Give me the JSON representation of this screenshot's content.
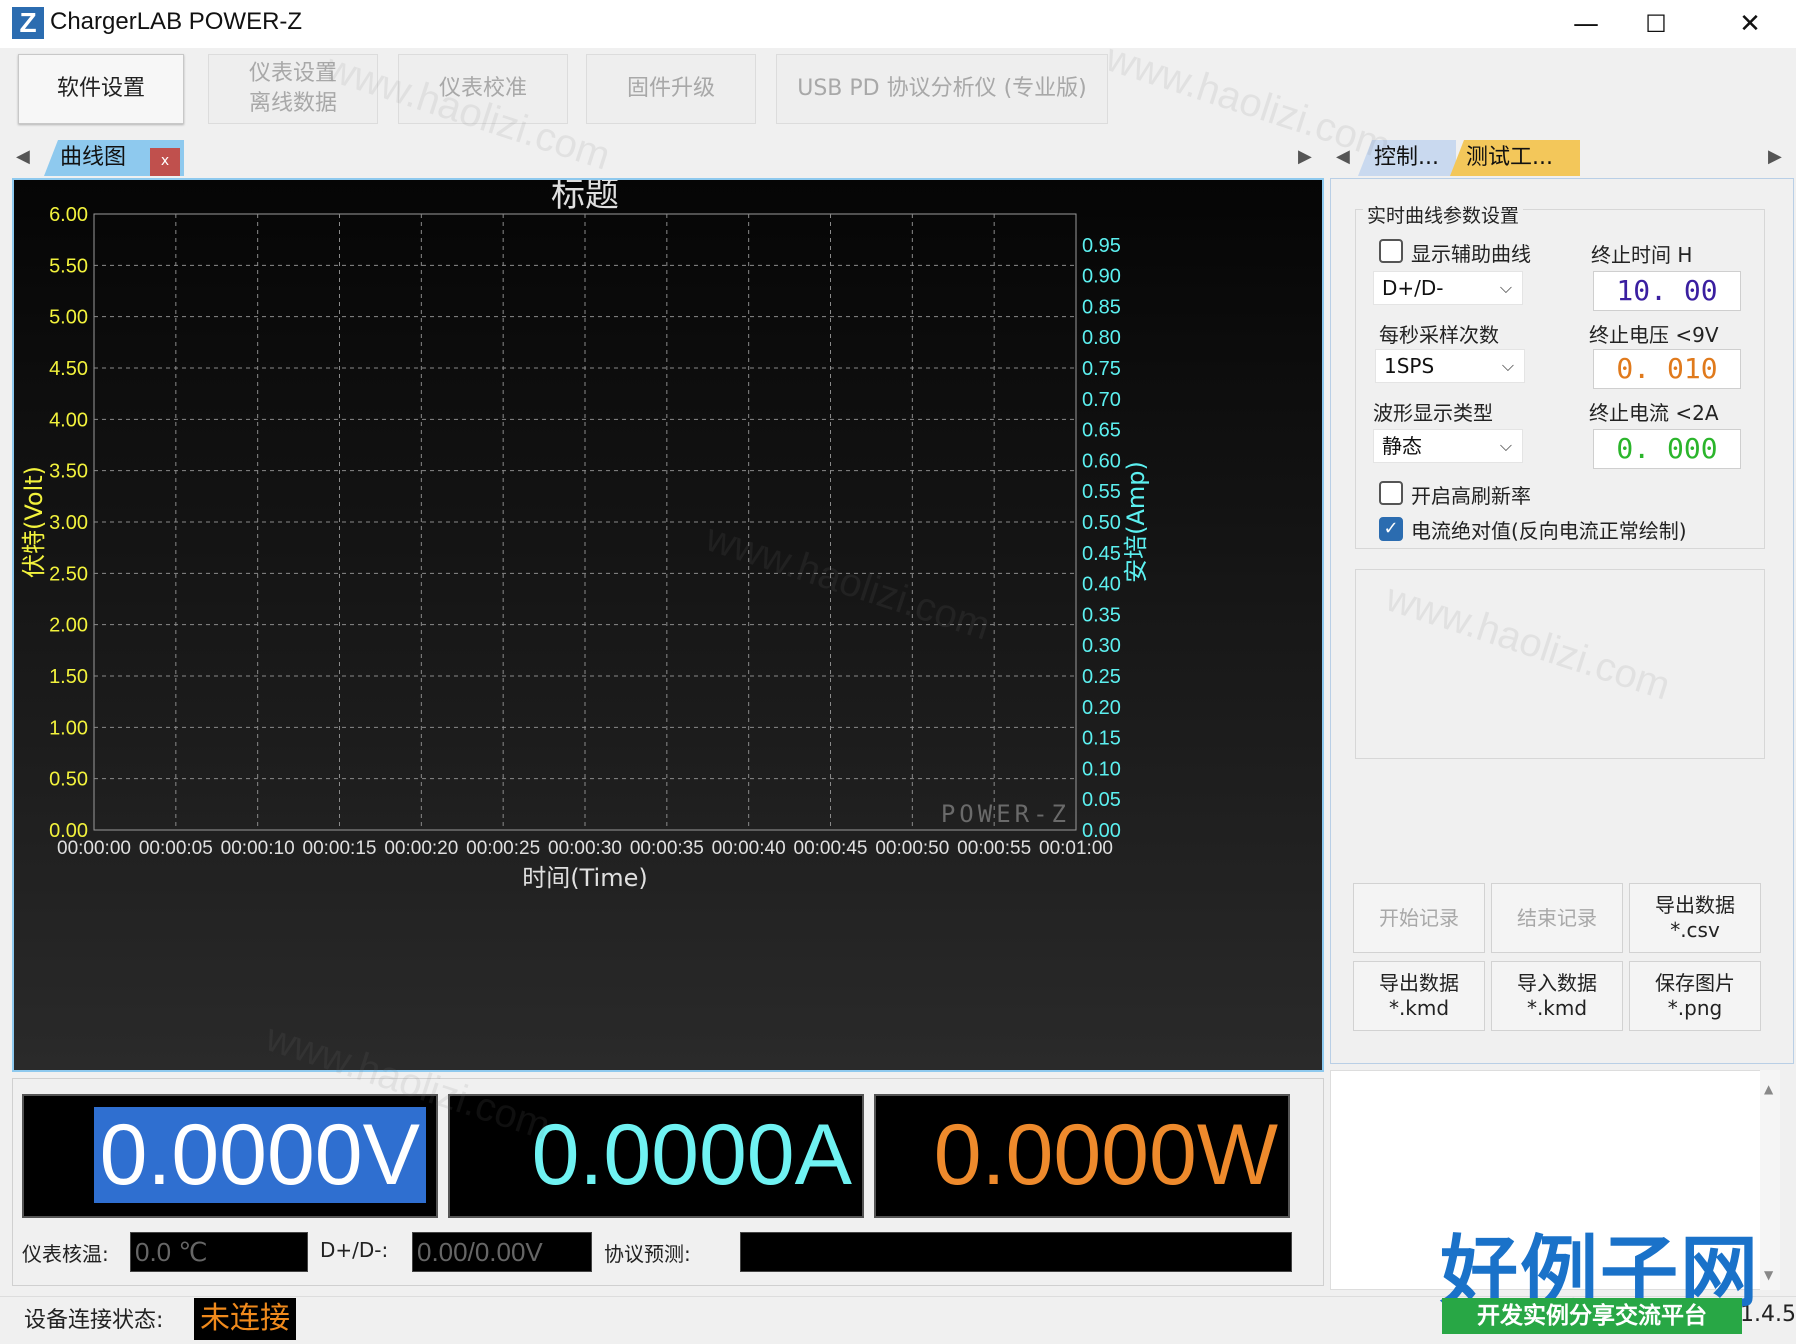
{
  "window": {
    "title": "ChargerLAB POWER-Z",
    "logo_glyph": "Z",
    "minimize": "—",
    "maximize": "☐",
    "close": "✕"
  },
  "toolbar": {
    "buttons": [
      {
        "label": "软件设置",
        "state": "active"
      },
      {
        "label": "仪表设置\n离线数据",
        "state": "disabled"
      },
      {
        "label": "仪表校准",
        "state": "disabled"
      },
      {
        "label": "固件升级",
        "state": "disabled"
      },
      {
        "label": "USB PD 协议分析仪 (专业版)",
        "state": "disabled"
      }
    ]
  },
  "left_tabs": {
    "active": "曲线图",
    "close": "x"
  },
  "right_tabs": {
    "tabs": [
      "控制...",
      "测试工..."
    ]
  },
  "chart_data": {
    "type": "line",
    "title": "标题",
    "xlabel": "时间(Time)",
    "ylabel_left": "伏特(Volt)",
    "ylabel_right": "安培(Amp)",
    "x_ticks": [
      "00:00:00",
      "00:00:05",
      "00:00:10",
      "00:00:15",
      "00:00:20",
      "00:00:25",
      "00:00:30",
      "00:00:35",
      "00:00:40",
      "00:00:45",
      "00:00:50",
      "00:00:55",
      "00:01:00"
    ],
    "y_left_ticks": [
      "0.00",
      "0.50",
      "1.00",
      "1.50",
      "2.00",
      "2.50",
      "3.00",
      "3.50",
      "4.00",
      "4.50",
      "5.00",
      "5.50",
      "6.00"
    ],
    "y_right_ticks": [
      "0.00",
      "0.05",
      "0.10",
      "0.15",
      "0.20",
      "0.25",
      "0.30",
      "0.35",
      "0.40",
      "0.45",
      "0.50",
      "0.55",
      "0.60",
      "0.65",
      "0.70",
      "0.75",
      "0.80",
      "0.85",
      "0.90",
      "0.95"
    ],
    "ylim_left": [
      0,
      6
    ],
    "ylim_right": [
      0,
      1
    ],
    "xlim_seconds": [
      0,
      60
    ],
    "grid": true,
    "series": [],
    "watermark": "POWER-Z",
    "colors": {
      "left_axis": "#f2f23c",
      "right_axis": "#5cf0f0",
      "text": "#e0e0e0",
      "grid": "#8a8a8a"
    }
  },
  "settings": {
    "group_title": "实时曲线参数设置",
    "show_aux_label": "显示辅助曲线",
    "show_aux_checked": false,
    "aux_select": "D+/D-",
    "sps_label": "每秒采样次数",
    "sps_select": "1SPS",
    "wave_label": "波形显示类型",
    "wave_select": "静态",
    "hi_refresh_label": "开启高刷新率",
    "hi_refresh_checked": false,
    "abs_current_label": "电流绝对值(反向电流正常绘制)",
    "abs_current_checked": true,
    "stop_time_label": "终止时间 H",
    "stop_time_value": "10. 00",
    "stop_voltage_label": "终止电压 <9V",
    "stop_voltage_value": "0. 010",
    "stop_current_label": "终止电流 <2A",
    "stop_current_value": "0. 000",
    "colors": {
      "time": "#3a1fa0",
      "voltage": "#e07a1c",
      "current": "#2bb52b"
    }
  },
  "actions": {
    "start_record": "开始记录",
    "stop_record": "结束记录",
    "export_csv": "导出数据\n*.csv",
    "export_kmd": "导出数据\n*.kmd",
    "import_kmd": "导入数据\n*.kmd",
    "save_png": "保存图片\n*.png"
  },
  "readouts": {
    "voltage": "0.0000V",
    "current": "0.0000A",
    "power": "0.0000W",
    "colors": {
      "voltage": "#ffffff",
      "current": "#6ff2f2",
      "power": "#ee8a2c"
    }
  },
  "info": {
    "temp_label": "仪表核温:",
    "temp_value": "0.0 ℃",
    "dpdm_label": "D+/D-:",
    "dpdm_value": "0.00/0.00V",
    "protocol_label": "协议预测:",
    "protocol_value": ""
  },
  "status": {
    "label": "设备连接状态:",
    "value": "未连接",
    "version_fragment": "1.4.5"
  },
  "overlay": {
    "site_logo": "好例子网",
    "site_slogan": "开发实例分享交流平台",
    "wm_url": "www.haolizi.com"
  }
}
